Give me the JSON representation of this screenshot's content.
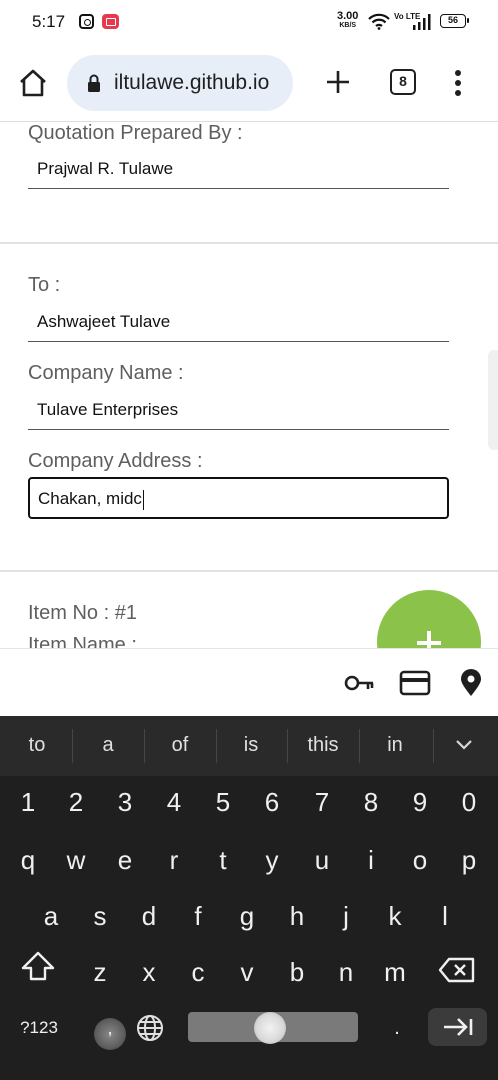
{
  "status_bar": {
    "time": "5:17",
    "net_speed_value": "3.00",
    "net_speed_unit": "KB/S",
    "volte": "Vo LTE",
    "battery": "56",
    "icons": [
      "instagram-icon",
      "screen-record-icon",
      "wifi-icon",
      "signal-icon",
      "battery-icon"
    ]
  },
  "browser": {
    "url": "iltulawe.github.io",
    "tab_count": "8",
    "icons": [
      "home-icon",
      "lock-icon",
      "new-tab-icon",
      "tab-switcher-icon",
      "overflow-menu-icon"
    ]
  },
  "form": {
    "prepared_by_label": "Quotation Prepared By :",
    "prepared_by_value": "Prajwal R. Tulawe",
    "to_label": "To :",
    "to_value": "Ashwajeet Tulave",
    "company_name_label": "Company Name :",
    "company_name_value": "Tulave Enterprises",
    "company_address_label": "Company Address :",
    "company_address_value": "Chakan, midc",
    "item_no_label": "Item No : #1",
    "item_name_label": "Item Name :",
    "fab_color": "#8bc34a"
  },
  "autofill": {
    "icons": [
      "key-icon",
      "credit-card-icon",
      "location-pin-icon"
    ]
  },
  "keyboard": {
    "suggestions": [
      "to",
      "a",
      "of",
      "is",
      "this",
      "in"
    ],
    "number_row": [
      "1",
      "2",
      "3",
      "4",
      "5",
      "6",
      "7",
      "8",
      "9",
      "0"
    ],
    "row1": [
      "q",
      "w",
      "e",
      "r",
      "t",
      "y",
      "u",
      "i",
      "o",
      "p"
    ],
    "row2": [
      "a",
      "s",
      "d",
      "f",
      "g",
      "h",
      "j",
      "k",
      "l"
    ],
    "row3": [
      "z",
      "x",
      "c",
      "v",
      "b",
      "n",
      "m"
    ],
    "symbols_label": "?123",
    "comma_label": ",",
    "period_label": ".",
    "bg_color": "#1f1f1f"
  }
}
